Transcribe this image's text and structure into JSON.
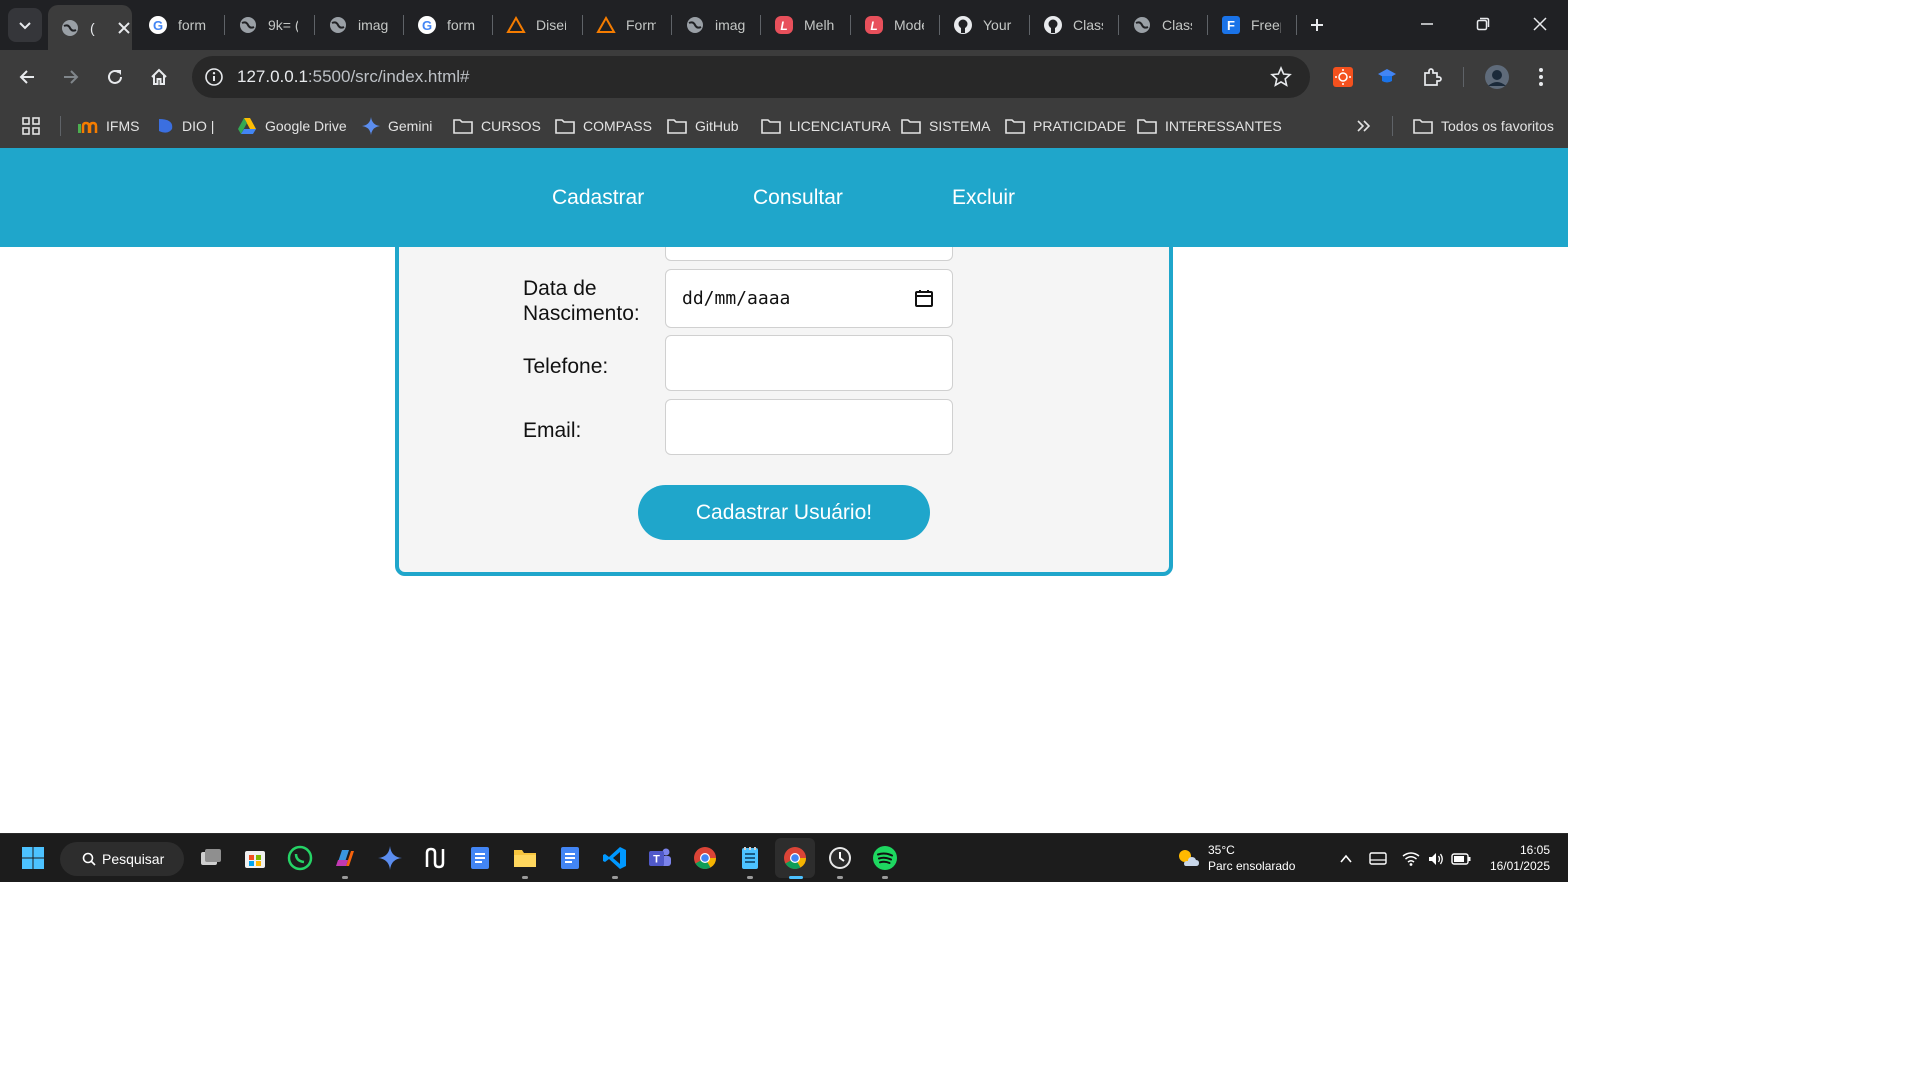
{
  "browser": {
    "tabs": [
      {
        "title": "(",
        "icon": "globe-icon",
        "active": true
      },
      {
        "title": "form",
        "icon": "google-icon"
      },
      {
        "title": "9k= (",
        "icon": "globe-icon"
      },
      {
        "title": "imag",
        "icon": "globe-icon"
      },
      {
        "title": "form",
        "icon": "google-icon"
      },
      {
        "title": "Diseñ",
        "icon": "triangle-icon"
      },
      {
        "title": "Form",
        "icon": "triangle-icon"
      },
      {
        "title": "imag",
        "icon": "globe-icon"
      },
      {
        "title": "Melh",
        "icon": "l-icon"
      },
      {
        "title": "Mode",
        "icon": "l-icon"
      },
      {
        "title": "Your",
        "icon": "github-icon"
      },
      {
        "title": "Classi",
        "icon": "github-icon"
      },
      {
        "title": "Classi",
        "icon": "globe-icon"
      },
      {
        "title": "Freep",
        "icon": "f-icon"
      }
    ],
    "url_host": "127.0.0.1",
    "url_path": ":5500/src/index.html#"
  },
  "bookmarks": {
    "items": [
      {
        "label": "IFMS",
        "icon": "ifms-icon"
      },
      {
        "label": "DIO |",
        "icon": "dio-icon"
      },
      {
        "label": "Google Drive",
        "icon": "drive-icon"
      },
      {
        "label": "Gemini",
        "icon": "gemini-icon"
      },
      {
        "label": "CURSOS",
        "icon": "folder-icon"
      },
      {
        "label": "COMPASS",
        "icon": "folder-icon"
      },
      {
        "label": "GitHub",
        "icon": "folder-icon"
      },
      {
        "label": "LICENCIATURA",
        "icon": "folder-icon"
      },
      {
        "label": "SISTEMA",
        "icon": "folder-icon"
      },
      {
        "label": "PRATICIDADE",
        "icon": "folder-icon"
      },
      {
        "label": "INTERESSANTES",
        "icon": "folder-icon"
      }
    ],
    "all_bookmarks": "Todos os favoritos"
  },
  "site": {
    "nav": [
      "Cadastrar",
      "Consultar",
      "Excluir"
    ],
    "form": {
      "birth_label_line1": "Data de",
      "birth_label_line2": "Nascimento:",
      "birth_placeholder": "dd/mm/aaaa",
      "phone_label": "Telefone:",
      "email_label": "Email:",
      "submit_label": "Cadastrar Usuário!"
    },
    "colors": {
      "primary": "#1fa6cb",
      "card_bg": "#f5f5f5"
    }
  },
  "taskbar": {
    "search_label": "Pesquisar",
    "weather_temp": "35°C",
    "weather_desc": "Parc ensolarado",
    "time": "16:05",
    "date": "16/01/2025"
  }
}
